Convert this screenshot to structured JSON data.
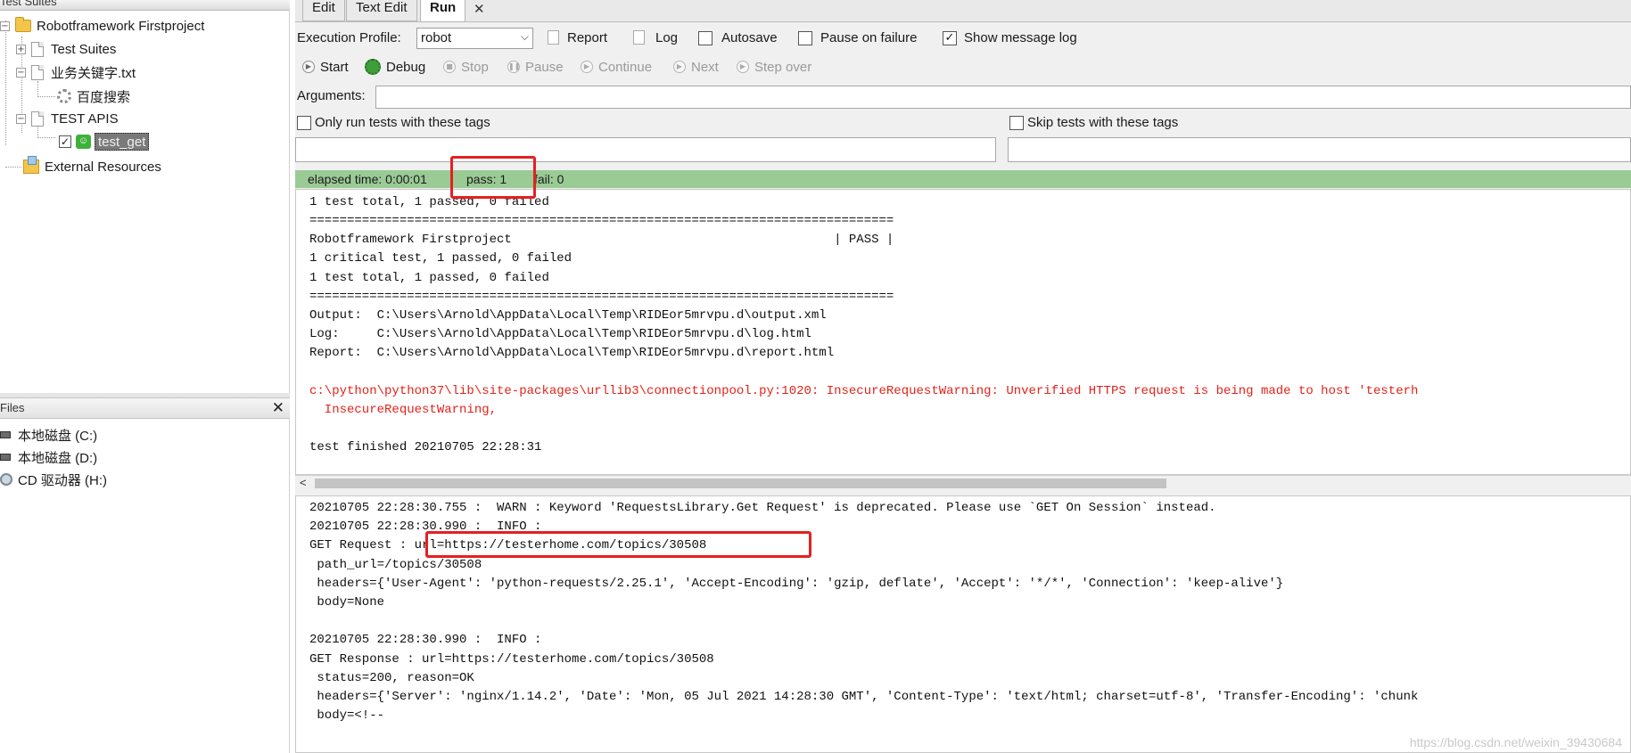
{
  "left": {
    "suites_header": "Test Suites",
    "tree": {
      "root": "Robotframework Firstproject",
      "test_suites": "Test Suites",
      "resource_file": "业务关键字.txt",
      "keyword": "百度搜索",
      "suite": "TEST APIS",
      "test_case": "test_get",
      "external": "External Resources"
    },
    "files_header": "Files",
    "files_close": "✕",
    "drives": [
      "本地磁盘 (C:)",
      "本地磁盘 (D:)",
      "CD 驱动器 (H:)"
    ]
  },
  "tabs": {
    "edit": "Edit",
    "text_edit": "Text Edit",
    "run": "Run",
    "close": "✕"
  },
  "run": {
    "profile_label": "Execution Profile:",
    "profile_value": "robot",
    "report": "Report",
    "log": "Log",
    "autosave": "Autosave",
    "pause_on_failure": "Pause on failure",
    "show_message_log": "Show message log",
    "show_message_log_checked": "✓",
    "buttons": {
      "start": "Start",
      "debug": "Debug",
      "stop": "Stop",
      "pause": "Pause",
      "continue": "Continue",
      "next": "Next",
      "step_over": "Step over"
    },
    "arguments_label": "Arguments:",
    "only_tags": "Only run tests with these tags",
    "skip_tags": "Skip tests with these tags"
  },
  "status": {
    "elapsed": "elapsed time: 0:00:01",
    "pass": "pass: 1",
    "fail": "fail: 0",
    "color": "#9acb95"
  },
  "console": {
    "l1": "1 test total, 1 passed, 0 failed",
    "sep1": "==============================================================================",
    "l3": "Robotframework Firstproject                                           | PASS |",
    "l4": "1 critical test, 1 passed, 0 failed",
    "l5": "1 test total, 1 passed, 0 failed",
    "sep2": "==============================================================================",
    "output": "Output:  C:\\Users\\Arnold\\AppData\\Local\\Temp\\RIDEor5mrvpu.d\\output.xml",
    "log": "Log:     C:\\Users\\Arnold\\AppData\\Local\\Temp\\RIDEor5mrvpu.d\\log.html",
    "report": "Report:  C:\\Users\\Arnold\\AppData\\Local\\Temp\\RIDEor5mrvpu.d\\report.html",
    "blank1": "",
    "warn1": "c:\\python\\python37\\lib\\site-packages\\urllib3\\connectionpool.py:1020: InsecureRequestWarning: Unverified HTTPS request is being made to host 'testerh",
    "warn2": "  InsecureRequestWarning,",
    "blank2": "",
    "finished": "test finished 20210705 22:28:31"
  },
  "log": {
    "l1": "20210705 22:28:30.755 :  WARN : Keyword 'RequestsLibrary.Get Request' is deprecated. Please use `GET On Session` instead.",
    "l2": "20210705 22:28:30.990 :  INFO :",
    "l3": "GET Request : url=https://testerhome.com/topics/30508",
    "l4": " path_url=/topics/30508",
    "l5": " headers={'User-Agent': 'python-requests/2.25.1', 'Accept-Encoding': 'gzip, deflate', 'Accept': '*/*', 'Connection': 'keep-alive'}",
    "l6": " body=None",
    "l7": "",
    "l8": "20210705 22:28:30.990 :  INFO :",
    "l9": "GET Response : url=https://testerhome.com/topics/30508",
    "l10": " status=200, reason=OK",
    "l11": " headers={'Server': 'nginx/1.14.2', 'Date': 'Mon, 05 Jul 2021 14:28:30 GMT', 'Content-Type': 'text/html; charset=utf-8', 'Transfer-Encoding': 'chunk",
    "l12": " body=<!--",
    "l13": "",
    "l14": "   _  _                    _                 _",
    "l15": "  | | |                   | |               | |"
  },
  "watermark": "https://blog.csdn.net/weixin_39430684",
  "colors": {
    "highlight": "#e42020",
    "error_text": "#e2231a"
  }
}
